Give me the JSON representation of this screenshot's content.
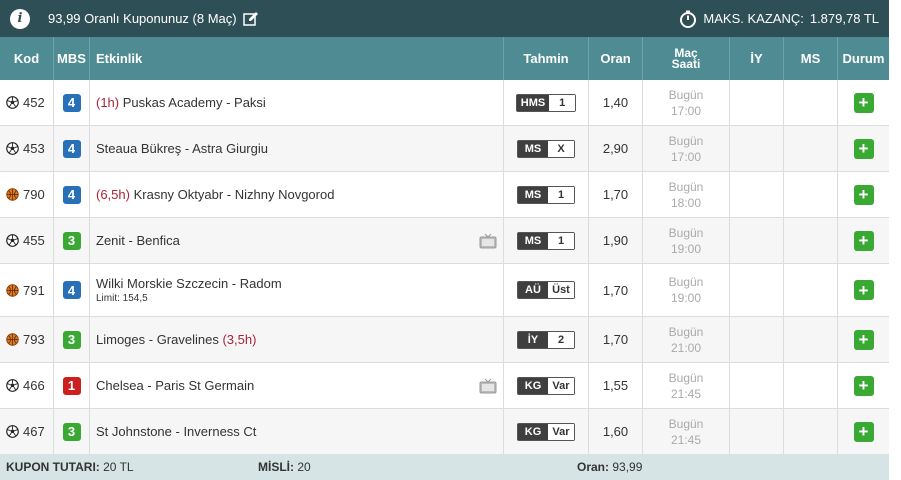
{
  "header": {
    "coupon_title": "93,99 Oranlı Kuponunuz (8 Maç)",
    "max_win_label": "MAKS. KAZANÇ:",
    "max_win_value": "1.879,78 TL"
  },
  "columns": {
    "kod": "Kod",
    "mbs": "MBS",
    "etkinlik": "Etkinlik",
    "tahmin": "Tahmin",
    "oran": "Oran",
    "mac_saati_1": "Maç",
    "mac_saati_2": "Saati",
    "iy": "İY",
    "ms": "MS",
    "durum": "Durum"
  },
  "colors": {
    "mbs_4": "#2870b8",
    "mbs_3": "#3aa934",
    "mbs_1": "#cc1f1f"
  },
  "rows": [
    {
      "sport": "soccer-ball-icon",
      "kod": "452",
      "mbs": "4",
      "tag": "(1h)",
      "tag_pos": "before",
      "event": "Puskas Academy - Paksi",
      "limit": "",
      "tv": false,
      "pred_key": "HMS",
      "pred_val": "1",
      "oran": "1,40",
      "day": "Bugün",
      "time": "17:00"
    },
    {
      "sport": "soccer-ball-icon",
      "kod": "453",
      "mbs": "4",
      "tag": "",
      "tag_pos": "",
      "event": "Steaua Bükreş - Astra Giurgiu",
      "limit": "",
      "tv": false,
      "pred_key": "MS",
      "pred_val": "X",
      "oran": "2,90",
      "day": "Bugün",
      "time": "17:00"
    },
    {
      "sport": "basketball-icon",
      "kod": "790",
      "mbs": "4",
      "tag": "(6,5h)",
      "tag_pos": "before",
      "event": "Krasny Oktyabr - Nizhny Novgorod",
      "limit": "",
      "tv": false,
      "pred_key": "MS",
      "pred_val": "1",
      "oran": "1,70",
      "day": "Bugün",
      "time": "18:00"
    },
    {
      "sport": "soccer-ball-icon",
      "kod": "455",
      "mbs": "3",
      "tag": "",
      "tag_pos": "",
      "event": "Zenit - Benfica",
      "limit": "",
      "tv": true,
      "pred_key": "MS",
      "pred_val": "1",
      "oran": "1,90",
      "day": "Bugün",
      "time": "19:00"
    },
    {
      "sport": "basketball-icon",
      "kod": "791",
      "mbs": "4",
      "tag": "",
      "tag_pos": "",
      "event": "Wilki Morskie Szczecin - Radom",
      "limit": "Limit: 154,5",
      "tv": false,
      "pred_key": "AÜ",
      "pred_val": "Üst",
      "oran": "1,70",
      "day": "Bugün",
      "time": "19:00"
    },
    {
      "sport": "basketball-icon",
      "kod": "793",
      "mbs": "3",
      "tag": "(3,5h)",
      "tag_pos": "after",
      "event": "Limoges - Gravelines",
      "limit": "",
      "tv": false,
      "pred_key": "İY",
      "pred_val": "2",
      "oran": "1,70",
      "day": "Bugün",
      "time": "21:00"
    },
    {
      "sport": "soccer-ball-icon",
      "kod": "466",
      "mbs": "1",
      "tag": "",
      "tag_pos": "",
      "event": "Chelsea - Paris St Germain",
      "limit": "",
      "tv": true,
      "pred_key": "KG",
      "pred_val": "Var",
      "oran": "1,55",
      "day": "Bugün",
      "time": "21:45"
    },
    {
      "sport": "soccer-ball-icon",
      "kod": "467",
      "mbs": "3",
      "tag": "",
      "tag_pos": "",
      "event": "St Johnstone - Inverness Ct",
      "limit": "",
      "tv": false,
      "pred_key": "KG",
      "pred_val": "Var",
      "oran": "1,60",
      "day": "Bugün",
      "time": "21:45"
    }
  ],
  "footer": {
    "kupon_label": "KUPON TUTARI:",
    "kupon_value": "20 TL",
    "misli_label": "MİSLİ:",
    "misli_value": "20",
    "oran_label": "Oran:",
    "oran_value": "93,99"
  }
}
